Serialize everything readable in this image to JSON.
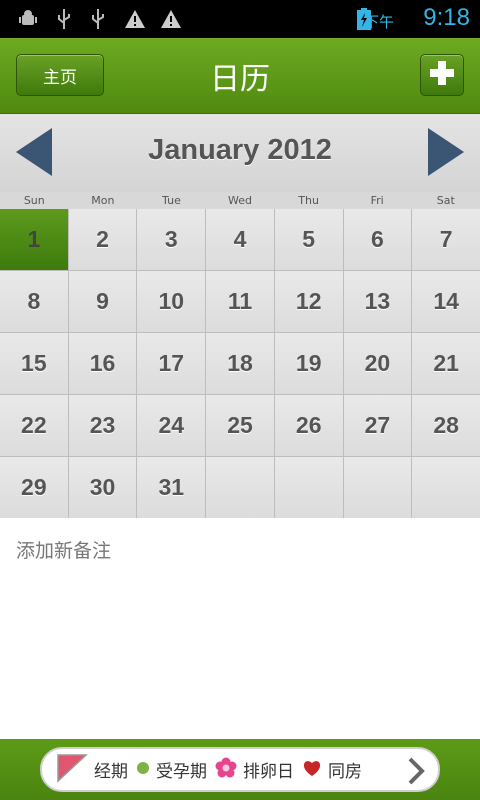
{
  "status_bar": {
    "ampm": "下午",
    "time": "9:18",
    "icons": [
      "android-debug-icon",
      "usb-icon",
      "usb-icon",
      "warning-icon",
      "warning-icon",
      "battery-charging-icon"
    ]
  },
  "header": {
    "home_label": "主页",
    "title": "日历",
    "add_icon": "plus-icon"
  },
  "calendar": {
    "month_label": "January 2012",
    "weekdays": [
      "Sun",
      "Mon",
      "Tue",
      "Wed",
      "Thu",
      "Fri",
      "Sat"
    ],
    "days": [
      "1",
      "2",
      "3",
      "4",
      "5",
      "6",
      "7",
      "8",
      "9",
      "10",
      "11",
      "12",
      "13",
      "14",
      "15",
      "16",
      "17",
      "18",
      "19",
      "20",
      "21",
      "22",
      "23",
      "24",
      "25",
      "26",
      "27",
      "28",
      "29",
      "30",
      "31",
      "",
      "",
      "",
      ""
    ],
    "today": "1"
  },
  "note": {
    "add_label": "添加新备注"
  },
  "legend": {
    "items": [
      {
        "label": "经期",
        "icon": "period-flag-icon",
        "color": "#e0566e"
      },
      {
        "label": "受孕期",
        "icon": "green-dot-icon",
        "color": "#7cb342"
      },
      {
        "label": "排卵日",
        "icon": "flower-icon",
        "color": "#e7448f"
      },
      {
        "label": "同房",
        "icon": "heart-icon",
        "color": "#c62828"
      }
    ]
  },
  "colors": {
    "accent_green": "#5d9a1d",
    "time_blue": "#33b5e5"
  }
}
